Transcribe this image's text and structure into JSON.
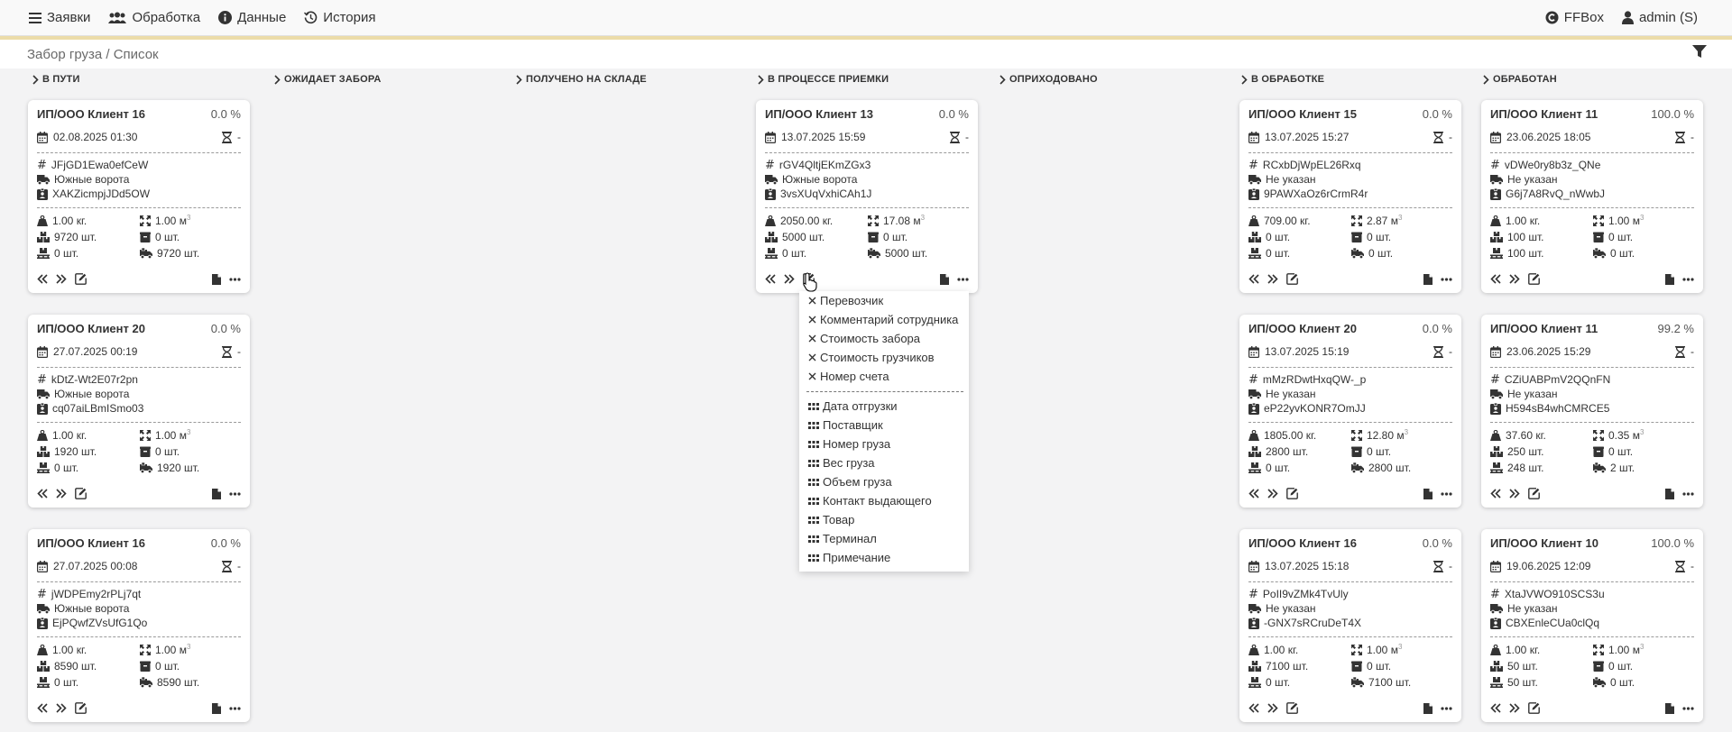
{
  "nav": {
    "requests": "Заявки",
    "processing": "Обработка",
    "data": "Данные",
    "history": "История",
    "brand": "FFBox",
    "user": "admin (S)"
  },
  "breadcrumb": "Забор груза / Список",
  "columns": [
    "В ПУТИ",
    "ОЖИДАЕТ ЗАБОРА",
    "ПОЛУЧЕНО НА СКЛАДЕ",
    "В ПРОЦЕССЕ ПРИЕМКИ",
    "ОПРИХОДОВАНО",
    "В ОБРАБОТКЕ",
    "ОБРАБОТАН"
  ],
  "cards": [
    {
      "title": "ИП/ООО Клиент 16",
      "pct": "0.0 %",
      "date": "02.08.2025 01:30",
      "dash": "-",
      "code": "JFjGD1Ewa0efCeW",
      "gate": "Южные ворота",
      "ref": "XAKZicmpjJDd5OW",
      "weight": "1.00 кг.",
      "volume": "1.00 м",
      "vol_unit": "3",
      "qty1": "9720 шт.",
      "qty2": "0 шт.",
      "qty3": "0 шт.",
      "qty4": "9720 шт."
    },
    {
      "title": "ИП/ООО Клиент 20",
      "pct": "0.0 %",
      "date": "27.07.2025 00:19",
      "dash": "-",
      "code": "kDtZ-Wt2E07r2pn",
      "gate": "Южные ворота",
      "ref": "cq07aiLBmISmo03",
      "weight": "1.00 кг.",
      "volume": "1.00 м",
      "vol_unit": "3",
      "qty1": "1920 шт.",
      "qty2": "0 шт.",
      "qty3": "0 шт.",
      "qty4": "1920 шт."
    },
    {
      "title": "ИП/ООО Клиент 16",
      "pct": "0.0 %",
      "date": "27.07.2025 00:08",
      "dash": "-",
      "code": "jWDPEmy2rPLj7qt",
      "gate": "Южные ворота",
      "ref": "EjPQwfZVsUfG1Qo",
      "weight": "1.00 кг.",
      "volume": "1.00 м",
      "vol_unit": "3",
      "qty1": "8590 шт.",
      "qty2": "0 шт.",
      "qty3": "0 шт.",
      "qty4": "8590 шт."
    },
    {
      "title": "ИП/ООО Клиент 13",
      "pct": "0.0 %",
      "date": "13.07.2025 15:59",
      "dash": "-",
      "code": "rGV4QltjEKmZGx3",
      "gate": "Южные ворота",
      "ref": "3vsXUqVxhiCAh1J",
      "weight": "2050.00 кг.",
      "volume": "17.08 м",
      "vol_unit": "3",
      "qty1": "5000 шт.",
      "qty2": "0 шт.",
      "qty3": "0 шт.",
      "qty4": "5000 шт."
    },
    {
      "title": "ИП/ООО Клиент 15",
      "pct": "0.0 %",
      "date": "13.07.2025 15:27",
      "dash": "-",
      "code": "RCxbDjWpEL26Rxq",
      "gate": "Не указан",
      "ref": "9PAWXaOz6rCrmR4r",
      "weight": "709.00 кг.",
      "volume": "2.87 м",
      "vol_unit": "3",
      "qty1": "0 шт.",
      "qty2": "0 шт.",
      "qty3": "0 шт.",
      "qty4": "0 шт."
    },
    {
      "title": "ИП/ООО Клиент 20",
      "pct": "0.0 %",
      "date": "13.07.2025 15:19",
      "dash": "-",
      "code": "mMzRDwtHxqQW-_p",
      "gate": "Не указан",
      "ref": "eP22yvKONR7OmJJ",
      "weight": "1805.00 кг.",
      "volume": "12.80 м",
      "vol_unit": "3",
      "qty1": "2800 шт.",
      "qty2": "0 шт.",
      "qty3": "0 шт.",
      "qty4": "2800 шт."
    },
    {
      "title": "ИП/ООО Клиент 16",
      "pct": "0.0 %",
      "date": "13.07.2025 15:18",
      "dash": "-",
      "code": "PoII9vZMk4TvUly",
      "gate": "Не указан",
      "ref": "-GNX7sRCruDeT4X",
      "weight": "1.00 кг.",
      "volume": "1.00 м",
      "vol_unit": "3",
      "qty1": "7100 шт.",
      "qty2": "0 шт.",
      "qty3": "0 шт.",
      "qty4": "7100 шт."
    },
    {
      "title": "ИП/ООО Клиент 11",
      "pct": "100.0 %",
      "date": "23.06.2025 18:05",
      "dash": "-",
      "code": "vDWe0ry8b3z_QNe",
      "gate": "Не указан",
      "ref": "G6j7A8RvQ_nWwbJ",
      "weight": "1.00 кг.",
      "volume": "1.00 м",
      "vol_unit": "3",
      "qty1": "100 шт.",
      "qty2": "0 шт.",
      "qty3": "100 шт.",
      "qty4": "0 шт."
    },
    {
      "title": "ИП/ООО Клиент 11",
      "pct": "99.2 %",
      "date": "23.06.2025 15:29",
      "dash": "-",
      "code": "CZiUABPmV2QQnFN",
      "gate": "Не указан",
      "ref": "H594sB4whCMRCE5",
      "weight": "37.60 кг.",
      "volume": "0.35 м",
      "vol_unit": "3",
      "qty1": "250 шт.",
      "qty2": "0 шт.",
      "qty3": "248 шт.",
      "qty4": "2 шт."
    },
    {
      "title": "ИП/ООО Клиент 10",
      "pct": "100.0 %",
      "date": "19.06.2025 12:09",
      "dash": "-",
      "code": "XtaJVWO910SCS3u",
      "gate": "Не указан",
      "ref": "CBXEnleCUa0clQq",
      "weight": "1.00 кг.",
      "volume": "1.00 м",
      "vol_unit": "3",
      "qty1": "50 шт.",
      "qty2": "0 шт.",
      "qty3": "50 шт.",
      "qty4": "0 шт."
    }
  ],
  "menu": {
    "hidden": [
      "Перевозчик",
      "Комментарий сотрудника",
      "Стоимость забора",
      "Стоимость грузчиков",
      "Номер счета"
    ],
    "visible": [
      "Дата отгрузки",
      "Поставщик",
      "Номер груза",
      "Вес груза",
      "Объем груза",
      "Контакт выдающего",
      "Товар",
      "Терминал",
      "Примечание"
    ]
  }
}
